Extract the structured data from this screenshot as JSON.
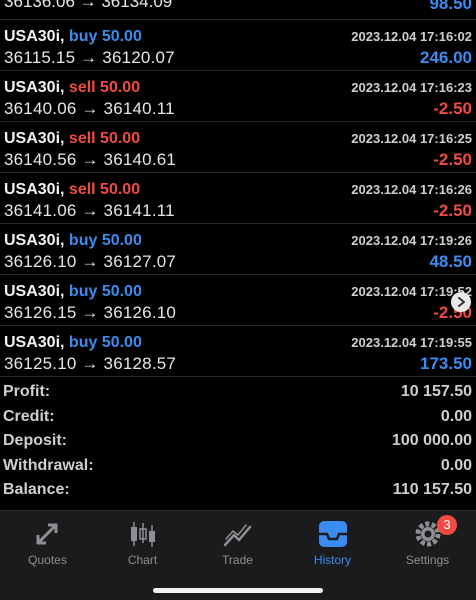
{
  "partial_top": {
    "prices": "36136.06 → 36134.09",
    "profit": "98.50"
  },
  "deals": [
    {
      "symbol": "USA30i,",
      "side": "buy 50.00",
      "side_type": "buy",
      "time": "2023.12.04 17:16:02",
      "prices": "36115.15 → 36120.07",
      "profit": "246.00",
      "profit_type": "pos"
    },
    {
      "symbol": "USA30i,",
      "side": "sell 50.00",
      "side_type": "sell",
      "time": "2023.12.04 17:16:23",
      "prices": "36140.06 → 36140.11",
      "profit": "-2.50",
      "profit_type": "neg"
    },
    {
      "symbol": "USA30i,",
      "side": "sell 50.00",
      "side_type": "sell",
      "time": "2023.12.04 17:16:25",
      "prices": "36140.56 → 36140.61",
      "profit": "-2.50",
      "profit_type": "neg"
    },
    {
      "symbol": "USA30i,",
      "side": "sell 50.00",
      "side_type": "sell",
      "time": "2023.12.04 17:16:26",
      "prices": "36141.06 → 36141.11",
      "profit": "-2.50",
      "profit_type": "neg"
    },
    {
      "symbol": "USA30i,",
      "side": "buy 50.00",
      "side_type": "buy",
      "time": "2023.12.04 17:19:26",
      "prices": "36126.10 → 36127.07",
      "profit": "48.50",
      "profit_type": "pos"
    },
    {
      "symbol": "USA30i,",
      "side": "buy 50.00",
      "side_type": "buy",
      "time": "2023.12.04 17:19:52",
      "prices": "36126.15 → 36126.10",
      "profit": "-2.50",
      "profit_type": "neg"
    },
    {
      "symbol": "USA30i,",
      "side": "buy 50.00",
      "side_type": "buy",
      "time": "2023.12.04 17:19:55",
      "prices": "36125.10 → 36128.57",
      "profit": "173.50",
      "profit_type": "pos"
    }
  ],
  "summary": [
    {
      "label": "Profit:",
      "value": "10 157.50"
    },
    {
      "label": "Credit:",
      "value": "0.00"
    },
    {
      "label": "Deposit:",
      "value": "100 000.00"
    },
    {
      "label": "Withdrawal:",
      "value": "0.00"
    },
    {
      "label": "Balance:",
      "value": "110 157.50"
    }
  ],
  "tabs": [
    {
      "label": "Quotes",
      "icon": "quotes-icon"
    },
    {
      "label": "Chart",
      "icon": "chart-icon"
    },
    {
      "label": "Trade",
      "icon": "trade-icon"
    },
    {
      "label": "History",
      "icon": "history-icon",
      "active": true
    },
    {
      "label": "Settings",
      "icon": "settings-icon",
      "badge": "3"
    }
  ],
  "colors": {
    "accent": "#3b8cf0",
    "loss": "#f04a44",
    "background": "#000000",
    "tabbar": "#1b1b1d"
  }
}
